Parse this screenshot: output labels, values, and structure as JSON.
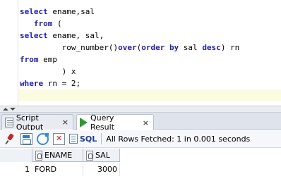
{
  "editor": {
    "lines": [
      {
        "kw1": "select",
        "rest": " ename,sal"
      },
      {
        "indent": "   ",
        "kw1": "from",
        "rest": " ("
      },
      {
        "kw1": "select",
        "rest": " ename, sal,"
      },
      {
        "pre": "         row_number()",
        "kw1": "over",
        "mid": "(",
        "kw2": "order by",
        "rest": " sal ",
        "kw3": "desc",
        "post": ") rn"
      },
      {
        "kw1": "from",
        "rest": " emp"
      },
      {
        "pre": "         ) x"
      },
      {
        "kw1": "where",
        "rest": " rn = 2;"
      }
    ]
  },
  "tabs": [
    {
      "label": "Script Output",
      "icon": "script-output-icon"
    },
    {
      "label": "Query Result",
      "icon": "run-query-icon",
      "active": true
    }
  ],
  "toolbar": {
    "sql_label": "SQL",
    "separator": "|",
    "status": "All Rows Fetched: 1 in 0.001 seconds"
  },
  "grid": {
    "columns": [
      "ENAME",
      "SAL"
    ],
    "rows": [
      {
        "num": "1",
        "ename": "FORD",
        "sal": "3000"
      }
    ]
  },
  "colors": {
    "keyword": "#1f1fa8",
    "current_line": "#fbfbe2",
    "tab_bar": "#dfe4ec"
  }
}
